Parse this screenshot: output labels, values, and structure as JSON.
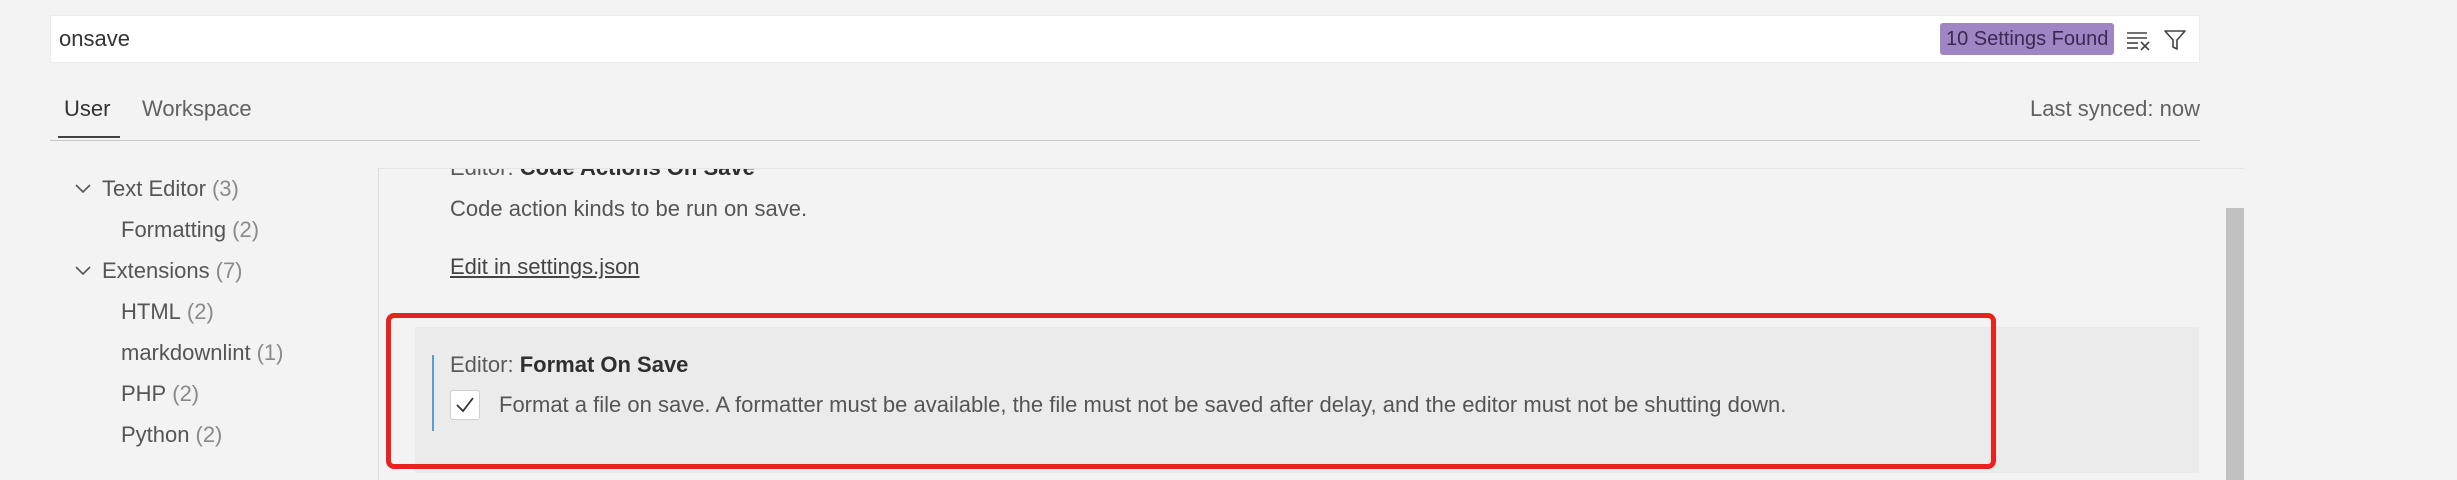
{
  "search": {
    "value": "onsave",
    "results_badge": "10 Settings Found",
    "clear_icon": "clear-filter-icon",
    "filter_icon": "funnel-filter-icon"
  },
  "tabs": [
    {
      "label": "User",
      "active": true
    },
    {
      "label": "Workspace",
      "active": false
    }
  ],
  "sync_status": "Last synced: now",
  "toc": [
    {
      "label": "Text Editor",
      "count": "(3)",
      "expanded": true
    },
    {
      "label": "Formatting",
      "count": "(2)"
    },
    {
      "label": "Extensions",
      "count": "(7)",
      "expanded": true
    },
    {
      "label": "HTML",
      "count": "(2)"
    },
    {
      "label": "markdownlint",
      "count": "(1)"
    },
    {
      "label": "PHP",
      "count": "(2)"
    },
    {
      "label": "Python",
      "count": "(2)"
    }
  ],
  "settings": [
    {
      "category": "Editor: ",
      "name": "Code Actions On Save",
      "description": "Code action kinds to be run on save.",
      "link": "Edit in settings.json"
    },
    {
      "category": "Editor: ",
      "name": "Format On Save",
      "description": "Format a file on save. A formatter must be available, the file must not be saved after delay, and the editor must not be shutting down.",
      "checked": true
    }
  ],
  "colors": {
    "badge": "#9f85c4",
    "highlight": "#e8231d",
    "focus_bar": "#5b9bd5"
  }
}
